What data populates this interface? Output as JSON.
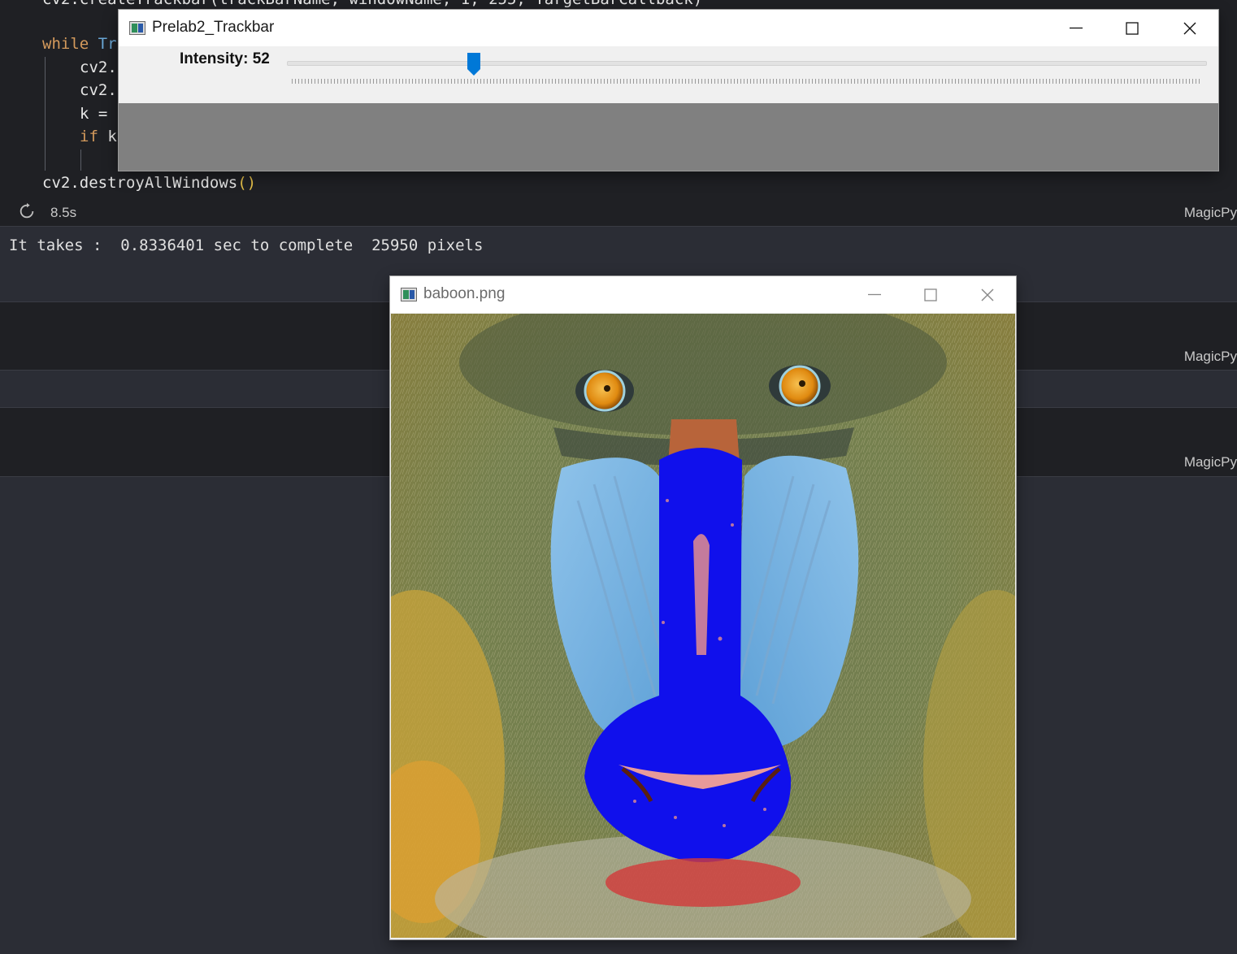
{
  "editor": {
    "line_top_partial": "cv2.createTrackbar(trackBarName, windowName, 1, 255, TargetBarCallback)",
    "line_while_kw": "while",
    "line_while_rest": " Tr",
    "line_cv2_a": "cv2.",
    "line_cv2_b": "cv2.",
    "line_k": "k = ",
    "line_if_kw": "if",
    "line_if_rest": " k",
    "line_destroy_fn": "cv2.destroyAllWindows",
    "line_destroy_parens": "()",
    "exec_time": "8.5s",
    "lang_tag": "MagicPy",
    "output_line": "It takes :  0.8336401 sec to complete  25950 pixels",
    "lang_tag_2": "MagicPy",
    "lang_tag_3": "MagicPy"
  },
  "trackbar_window": {
    "title": "Prelab2_Trackbar",
    "trackbar_label": "Intensity: 52",
    "trackbar_value": 52,
    "trackbar_max": 255,
    "accent_color": "#0078d7",
    "controls": [
      "minimize-icon",
      "maximize-icon",
      "close-icon"
    ]
  },
  "image_window": {
    "title": "baboon.png",
    "controls": [
      "minimize-icon",
      "maximize-icon",
      "close-icon"
    ]
  }
}
